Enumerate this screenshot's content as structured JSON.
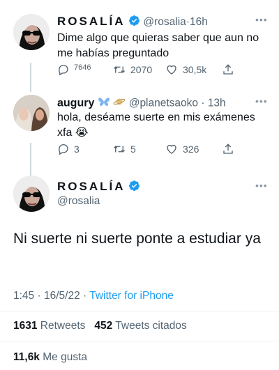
{
  "tweet1": {
    "name": "ROSALÍA",
    "handle": "@rosalia",
    "time": "16h",
    "text": "Dime algo que quieras saber que aun no me habías preguntado",
    "replies": "7646",
    "retweets": "2070",
    "likes": "30,5k"
  },
  "tweet2": {
    "name": "augury",
    "handle": "@planetsaoko",
    "time": "13h",
    "text": "hola, deséame suerte en mis exámenes xfa 😭",
    "replies": "3",
    "retweets": "5",
    "likes": "326",
    "emoji_after_name": [
      "butterfly",
      "saturn"
    ]
  },
  "main_tweet": {
    "name": "ROSALÍA",
    "handle": "@rosalia",
    "text": "Ni suerte ni suerte ponte a estudiar ya",
    "time": "1:45",
    "date": "16/5/22",
    "source": "Twitter for iPhone",
    "retweets_count": "1631",
    "retweets_label": "Retweets",
    "quotes_count": "452",
    "quotes_label": "Tweets citados",
    "likes_count": "11,6k",
    "likes_label": "Me gusta"
  },
  "colors": {
    "verified": "#1d9bf0",
    "link": "#1d9bf0",
    "secondary": "#536471",
    "thread_line": "#cfd9de"
  }
}
